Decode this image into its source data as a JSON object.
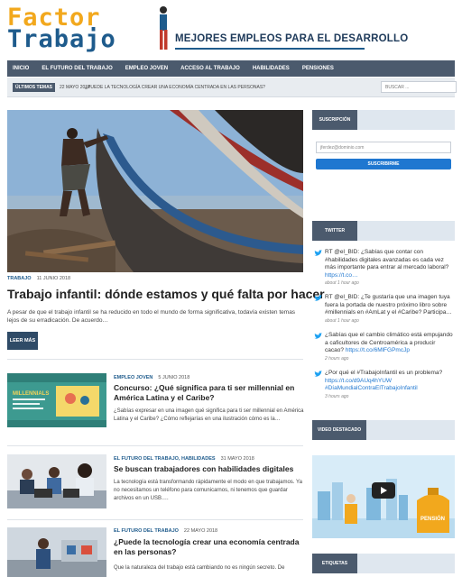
{
  "logo": {
    "line1": "Factor",
    "line2": "Trabajo",
    "tagline": "MEJORES EMPLEOS PARA EL DESARROLLO"
  },
  "nav": [
    "INICIO",
    "EL FUTURO DEL TRABAJO",
    "EMPLEO JOVEN",
    "ACCESO AL TRABAJO",
    "HABILIDADES",
    "PENSIONES"
  ],
  "ticker": {
    "tag": "ÚLTIMOS TEMAS",
    "date": "22 MAYO 2018",
    "text": "¿PUEDE LA TECNOLOGÍA CREAR UNA ECONOMÍA CENTRADA EN LAS PERSONAS?",
    "search_placeholder": "BUSCAR ..."
  },
  "hero": {
    "category": "TRABAJO",
    "date": "11 JUNIO 2018",
    "title": "Trabajo infantil: dónde estamos y qué falta por hacer",
    "excerpt": "A pesar de que el trabajo infantil se ha reducido en todo el mundo de forma significativa, todavía existen temas lejos de su erradicación. De acuerdo…",
    "button": "LEER MÁS"
  },
  "articles": [
    {
      "category": "EMPLEO JOVEN",
      "date": "5 JUNIO 2018",
      "title": "Concurso: ¿Qué significa para ti ser millennial en América Latina y el Caribe?",
      "excerpt": "¿Sabías expresar en una imagen qué significa para ti ser millennial en América Latina y el Caribe? ¿Cómo reflejarías en una ilustración cómo es la…",
      "thumb_text": "MILLENNIALS"
    },
    {
      "category": "EL FUTURO DEL TRABAJO, HABILIDADES",
      "date": "31 MAYO 2018",
      "title": "Se buscan trabajadores con habilidades digitales",
      "excerpt": "La tecnología está transformando rápidamente el modo en que trabajamos. Ya no necesitamos un teléfono para comunicarnos, ni tenemos que guardar archivos en un USB…."
    },
    {
      "category": "EL FUTURO DEL TRABAJO",
      "date": "22 MAYO 2018",
      "title": "¿Puede la tecnología crear una economía centrada en las personas?",
      "excerpt": "Que la naturaleza del trabajo está cambiando no es ningún secreto. De"
    }
  ],
  "sidebar": {
    "subscription": {
      "title": "SUSCRIPCIÓN",
      "email_placeholder": "jferdez@dominio.com",
      "button": "SUSCRIBIRME"
    },
    "twitter": {
      "title": "TWITTER",
      "tweets": [
        {
          "text": "RT @el_BID: ¿Sabías que contar con #habilidades digitales avanzadas es cada vez más importante para entrar al mercado laboral?",
          "link": "https://t.co…",
          "time": "about 1 hour ago"
        },
        {
          "text": "RT @el_BID: ¿Te gustaría que una imagen tuya fuera la portada de nuestro próximo libro sobre #millennials en #AmLat y el #Caribe? Participa…",
          "link": "",
          "time": "about 1 hour ago"
        },
        {
          "text": "¿Sabías que el cambio climático está empujando a caficultores de Centroamérica a producir cacao?",
          "link": "https://t.co/6MlFGPmcJp",
          "time": "2 hours ago"
        },
        {
          "text": "¿Por qué el #TrabajoInfantil es un problema?",
          "link": "https://t.co/d9AUq4hYUW #DíaMundialContraElTrabajoInfantil",
          "time": "3 hours ago"
        }
      ]
    },
    "video": {
      "title": "VIDEO DESTACADO",
      "label": "PENSIÓN"
    },
    "tags": {
      "title": "ETIQUETAS"
    }
  },
  "colors": {
    "brand_orange": "#f2a81d",
    "brand_blue": "#1e5b8c",
    "nav_bg": "#4b5a6d",
    "link": "#1f77d0"
  }
}
